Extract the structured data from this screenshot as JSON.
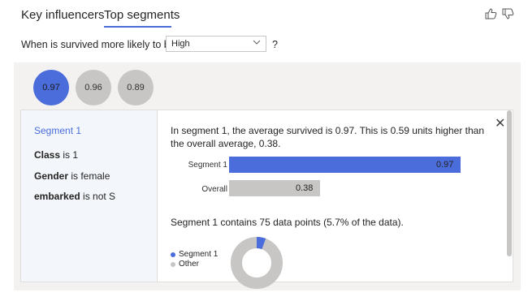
{
  "tabs": [
    {
      "label": "Key influencers",
      "active": false
    },
    {
      "label": "Top segments",
      "active": true
    }
  ],
  "feedback": {
    "up_icon": "thumbs-up-icon",
    "down_icon": "thumbs-down-icon"
  },
  "question": {
    "prefix": "When is survived more likely to be",
    "selected": "High",
    "suffix": "?"
  },
  "bubbles": [
    {
      "label": "0.97",
      "selected": true
    },
    {
      "label": "0.96",
      "selected": false
    },
    {
      "label": "0.89",
      "selected": false
    }
  ],
  "segment": {
    "title": "Segment 1",
    "conditions": [
      {
        "field": "Class",
        "rest": " is 1"
      },
      {
        "field": "Gender",
        "rest": " is female"
      },
      {
        "field": "embarked",
        "rest": " is not S"
      }
    ],
    "summary": "In segment 1, the average survived is 0.97. This is 0.59 units higher than the overall average, 0.38.",
    "bars": [
      {
        "label": "Segment 1",
        "value": 0.97,
        "display": "0.97",
        "color": "#4a6ddb"
      },
      {
        "label": "Overall",
        "value": 0.38,
        "display": "0.38",
        "color": "#c8c6c4"
      }
    ],
    "datapoints": "Segment 1 contains 75 data points (5.7% of the data).",
    "legend": [
      {
        "label": "Segment 1",
        "color": "#4a6ddb"
      },
      {
        "label": "Other",
        "color": "#c8c6c4"
      }
    ],
    "share": 0.057
  },
  "colors": {
    "accent": "#4a6ddb",
    "grey": "#c8c6c4"
  }
}
